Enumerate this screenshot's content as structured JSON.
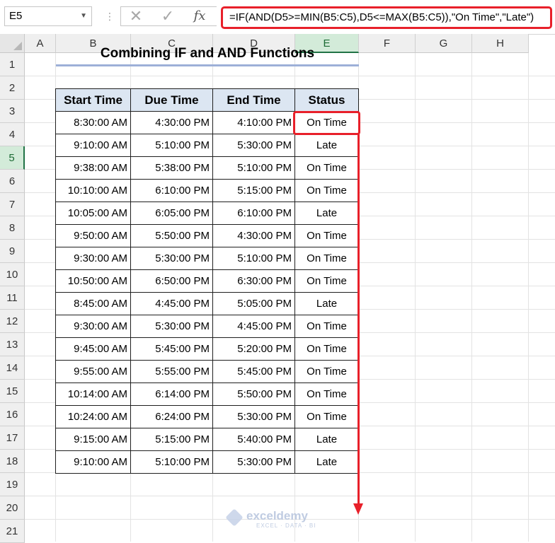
{
  "formula_bar": {
    "name_box": "E5",
    "cancel_icon": "✕",
    "enter_icon": "✓",
    "fx_icon": "fx",
    "formula": "=IF(AND(D5>=MIN(B5:C5),D5<=MAX(B5:C5)),\"On Time\",\"Late\")"
  },
  "columns": [
    "A",
    "B",
    "C",
    "D",
    "E",
    "F",
    "G",
    "H"
  ],
  "rows": [
    "1",
    "2",
    "3",
    "4",
    "5",
    "6",
    "7",
    "8",
    "9",
    "10",
    "11",
    "12",
    "13",
    "14",
    "15",
    "16",
    "17",
    "18",
    "19",
    "20",
    "21"
  ],
  "title": "Combining IF and AND Functions",
  "table": {
    "headers": [
      "Start Time",
      "Due Time",
      "End Time",
      "Status"
    ],
    "rows": [
      [
        "8:30:00 AM",
        "4:30:00 PM",
        "4:10:00 PM",
        "On Time"
      ],
      [
        "9:10:00 AM",
        "5:10:00 PM",
        "5:30:00 PM",
        "Late"
      ],
      [
        "9:38:00 AM",
        "5:38:00 PM",
        "5:10:00 PM",
        "On Time"
      ],
      [
        "10:10:00 AM",
        "6:10:00 PM",
        "5:15:00 PM",
        "On Time"
      ],
      [
        "10:05:00 AM",
        "6:05:00 PM",
        "6:10:00 PM",
        "Late"
      ],
      [
        "9:50:00 AM",
        "5:50:00 PM",
        "4:30:00 PM",
        "On Time"
      ],
      [
        "9:30:00 AM",
        "5:30:00 PM",
        "5:10:00 PM",
        "On Time"
      ],
      [
        "10:50:00 AM",
        "6:50:00 PM",
        "6:30:00 PM",
        "On Time"
      ],
      [
        "8:45:00 AM",
        "4:45:00 PM",
        "5:05:00 PM",
        "Late"
      ],
      [
        "9:30:00 AM",
        "5:30:00 PM",
        "4:45:00 PM",
        "On Time"
      ],
      [
        "9:45:00 AM",
        "5:45:00 PM",
        "5:20:00 PM",
        "On Time"
      ],
      [
        "9:55:00 AM",
        "5:55:00 PM",
        "5:45:00 PM",
        "On Time"
      ],
      [
        "10:14:00 AM",
        "6:14:00 PM",
        "5:50:00 PM",
        "On Time"
      ],
      [
        "10:24:00 AM",
        "6:24:00 PM",
        "5:30:00 PM",
        "On Time"
      ],
      [
        "9:15:00 AM",
        "5:15:00 PM",
        "5:40:00 PM",
        "Late"
      ],
      [
        "9:10:00 AM",
        "5:10:00 PM",
        "5:30:00 PM",
        "Late"
      ]
    ]
  },
  "watermark": {
    "name": "exceldemy",
    "tagline": "EXCEL · DATA · BI"
  },
  "colors": {
    "accent_red": "#e8202a",
    "header_fill": "#dce6f2",
    "selection_green": "#217346"
  }
}
